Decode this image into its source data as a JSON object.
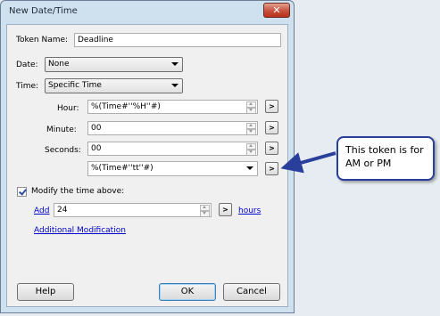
{
  "window": {
    "title": "New Date/Time",
    "close_glyph": "✕"
  },
  "form": {
    "token_name_label": "Token Name:",
    "token_name_value": "Deadline",
    "date_label": "Date:",
    "date_value": "None",
    "time_label": "Time:",
    "time_value": "Specific Time",
    "hour_label": "Hour:",
    "hour_value": "%(Time#''%H''#)",
    "minute_label": "Minute:",
    "minute_value": "00",
    "seconds_label": "Seconds:",
    "seconds_value": "00",
    "ampm_value": "%(Time#''tt''#)",
    "picker_glyph": ">"
  },
  "modify": {
    "checkbox_label": "Modify the time above:",
    "checked": true,
    "add_link": "Add",
    "amount_value": "24",
    "unit_link": "hours",
    "additional_link": "Additional Modification"
  },
  "buttons": {
    "help": "Help",
    "ok": "OK",
    "cancel": "Cancel"
  },
  "callout": {
    "text": "This token is for AM or PM",
    "color": "#2a3f9c"
  }
}
